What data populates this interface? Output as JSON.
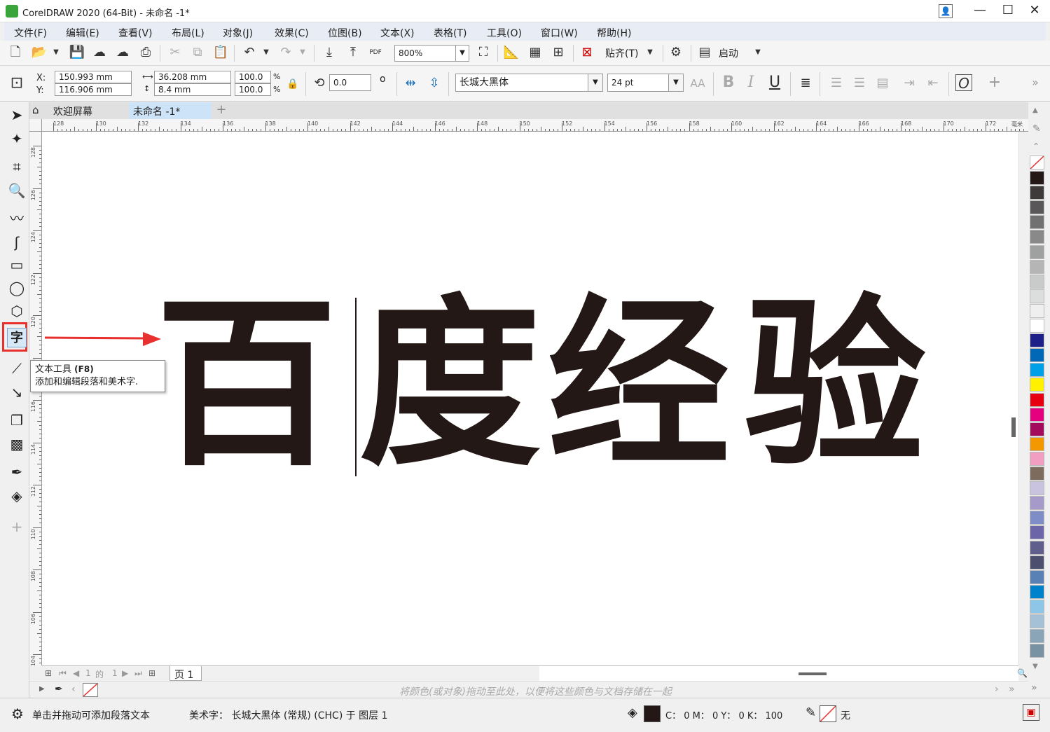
{
  "window": {
    "title": "CorelDRAW 2020 (64-Bit) - 未命名 -1*",
    "controls": {
      "minimize": "—",
      "maximize": "☐",
      "close": "✕"
    }
  },
  "menu": {
    "items": [
      "文件(F)",
      "编辑(E)",
      "查看(V)",
      "布局(L)",
      "对象(J)",
      "效果(C)",
      "位图(B)",
      "文本(X)",
      "表格(T)",
      "工具(O)",
      "窗口(W)",
      "帮助(H)"
    ]
  },
  "standard_toolbar": {
    "zoom_value": "800%",
    "snap_label": "贴齐(T)",
    "launch_label": "启动"
  },
  "property_bar": {
    "x_label": "X:",
    "x_value": "150.993 mm",
    "y_label": "Y:",
    "y_value": "116.906 mm",
    "width_value": "36.208 mm",
    "height_value": "8.4 mm",
    "scale_x": "100.0",
    "scale_y": "100.0",
    "percent": "%",
    "rotation_value": "0.0",
    "rotation_unit": "o",
    "font_name": "长城大黑体",
    "font_size": "24 pt"
  },
  "doc_tabs": {
    "welcome": "欢迎屏幕",
    "document": "未命名 -1*"
  },
  "ruler": {
    "h_ticks": [
      "128",
      "130",
      "132",
      "134",
      "136",
      "138",
      "140",
      "142",
      "144",
      "146",
      "148",
      "150",
      "152",
      "154",
      "156",
      "158",
      "160",
      "162",
      "164",
      "166",
      "168",
      "170",
      "172"
    ],
    "h_unit": "毫米",
    "v_ticks": [
      "128",
      "126",
      "124",
      "122",
      "120",
      "118",
      "116",
      "114",
      "112",
      "110",
      "108",
      "106",
      "104"
    ]
  },
  "canvas": {
    "artistic_text": [
      "百",
      "度",
      "经",
      "验"
    ]
  },
  "tooltip": {
    "title": "文本工具",
    "shortcut": "(F8)",
    "description": "添加和编辑段落和美术字."
  },
  "pager": {
    "current": "1",
    "of": "的",
    "total": "1",
    "page_tab": "页 1"
  },
  "doc_palette_hint": "将颜色(或对象)拖动至此处，以便将这些颜色与文档存储在一起",
  "status": {
    "hint": "单击并拖动可添加段落文本",
    "object_info": "美术字：  长城大黑体 (常规) (CHC) 于 图层 1",
    "fill_cmyk": "C：  0 M：  0 Y：  0 K：  100",
    "outline": "无"
  },
  "palette_colors": [
    "#231815",
    "#3e3a39",
    "#595757",
    "#727171",
    "#898989",
    "#9fa0a0",
    "#b5b5b6",
    "#c9caca",
    "#dcdddd",
    "#efefef",
    "#ffffff",
    "#1d2088",
    "#0068b7",
    "#00a0e9",
    "#fff100",
    "#e60012",
    "#e4007f",
    "#a40b5d",
    "#f39800",
    "#f19ec2",
    "#7d6b5d",
    "#c9c3e0",
    "#a59aca",
    "#7e8cc8",
    "#6c66a8",
    "#605e8c",
    "#4d4f6e",
    "#5a81b5",
    "#0081cc",
    "#8ec6e8",
    "#a4c1d7",
    "#8aa4b8",
    "#7891a3"
  ],
  "colors": {
    "accent_red": "#e8312f",
    "text_fill": "#231815",
    "highlight_tool": "#d7e9f7"
  }
}
